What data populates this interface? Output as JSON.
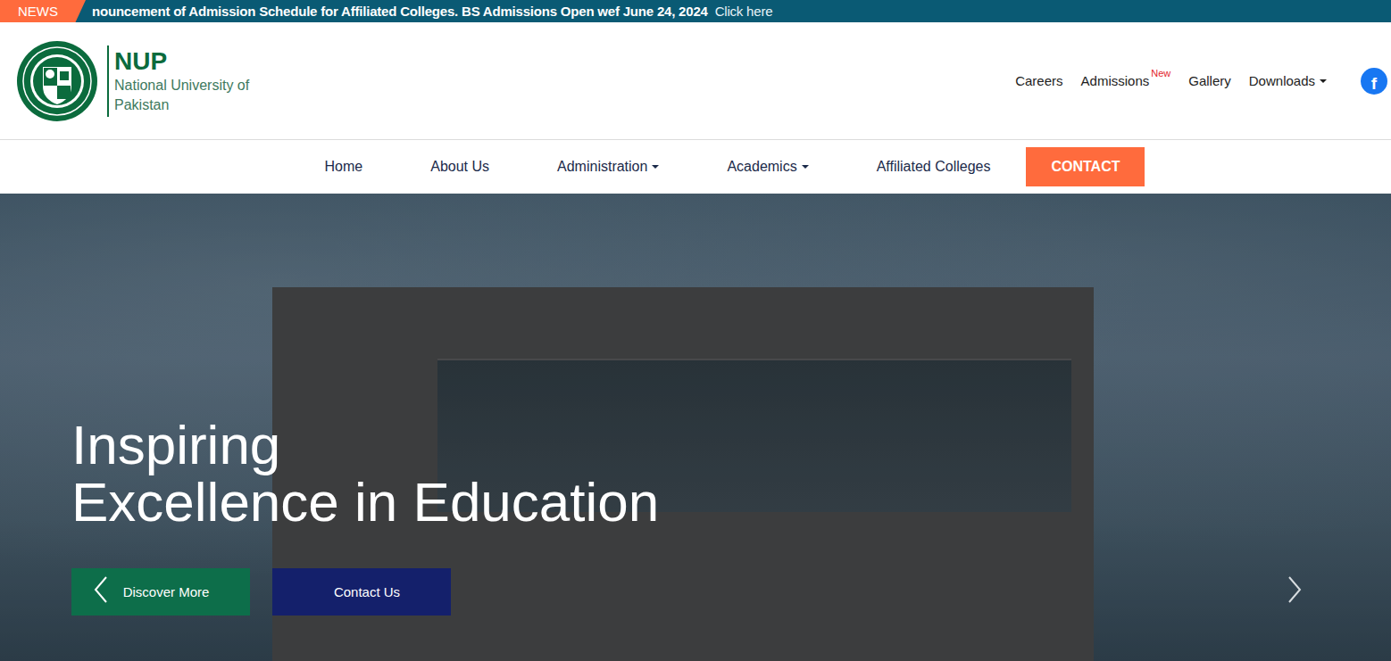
{
  "news": {
    "label": "NEWS",
    "text": "nouncement of Admission Schedule for Affiliated Colleges. BS Admissions Open wef June 24, 2024",
    "link": "Click here"
  },
  "brand": {
    "short": "NUP",
    "name_lines": [
      "National University of",
      "Pakistan"
    ]
  },
  "top_links": [
    {
      "label": "Careers",
      "dropdown": false
    },
    {
      "label": "Admissions",
      "badge": "New",
      "dropdown": false
    },
    {
      "label": "Gallery",
      "dropdown": false
    },
    {
      "label": "Downloads",
      "dropdown": true
    }
  ],
  "social": {
    "facebook": "f"
  },
  "main_nav": [
    {
      "label": "Home",
      "dropdown": false,
      "kind": "link"
    },
    {
      "label": "About Us",
      "dropdown": false,
      "kind": "link"
    },
    {
      "label": "Administration",
      "dropdown": true,
      "kind": "link"
    },
    {
      "label": "Academics",
      "dropdown": true,
      "kind": "link"
    },
    {
      "label": "Affiliated Colleges",
      "dropdown": false,
      "kind": "link"
    },
    {
      "label": "CONTACT",
      "dropdown": false,
      "kind": "button"
    }
  ],
  "hero": {
    "title_lines": [
      "Inspiring",
      "Excellence in Education"
    ],
    "buttons": [
      {
        "label": "Discover More",
        "color": "#0d6e4a"
      },
      {
        "label": "Contact Us",
        "color": "#14206b"
      }
    ]
  }
}
